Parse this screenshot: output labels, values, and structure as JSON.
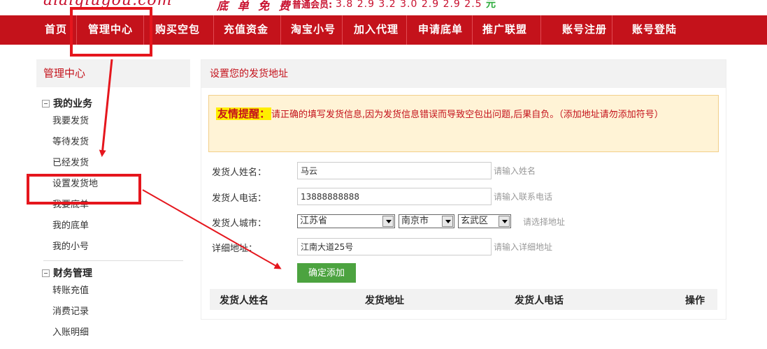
{
  "header": {
    "logo_text": "aiaiqiugou.com",
    "slogan": "底 单 免 费",
    "price_label": "普通会员:",
    "price_values": "3.8 2.9 3.2 3.0 2.9 2.9 2.5",
    "price_unit": "元"
  },
  "nav": {
    "items": [
      "首页",
      "管理中心",
      "购买空包",
      "充值资金",
      "淘宝小号",
      "加入代理",
      "申请底单",
      "推广联盟",
      "账号注册",
      "账号登陆"
    ]
  },
  "sidebar": {
    "title": "管理中心",
    "groups": [
      {
        "title": "我的业务",
        "items": [
          "我要发货",
          "等待发货",
          "已经发货",
          "设置发货地",
          "我要底单",
          "我的底单",
          "我的小号"
        ]
      },
      {
        "title": "财务管理",
        "items": [
          "转账充值",
          "消费记录",
          "入账明细"
        ]
      }
    ]
  },
  "main": {
    "title": "设置您的发货地址",
    "notice_label": "友情提醒：",
    "notice_text": "请正确的填写发货信息,因为发货信息错误而导致空包出问题,后果自负。（添加地址请勿添加符号）",
    "form": {
      "name_label": "发货人姓名：",
      "name_value": "马云",
      "name_hint": "请输入姓名",
      "phone_label": "发货人电话：",
      "phone_value": "13888888888",
      "phone_hint": "请输入联系电话",
      "city_label": "发货人城市：",
      "province": "江苏省",
      "city": "南京市",
      "district": "玄武区",
      "city_hint": "请选择地址",
      "address_label": "详细地址：",
      "address_value": "江南大道25号",
      "address_hint": "请输入详细地址",
      "submit_label": "确定添加"
    },
    "table": {
      "headers": [
        "发货人姓名",
        "发货地址",
        "发货人电话",
        "操作"
      ]
    }
  },
  "colors": {
    "brand_red": "#c4121b",
    "annotation_red": "#e5161d",
    "submit_green": "#4ca340"
  }
}
